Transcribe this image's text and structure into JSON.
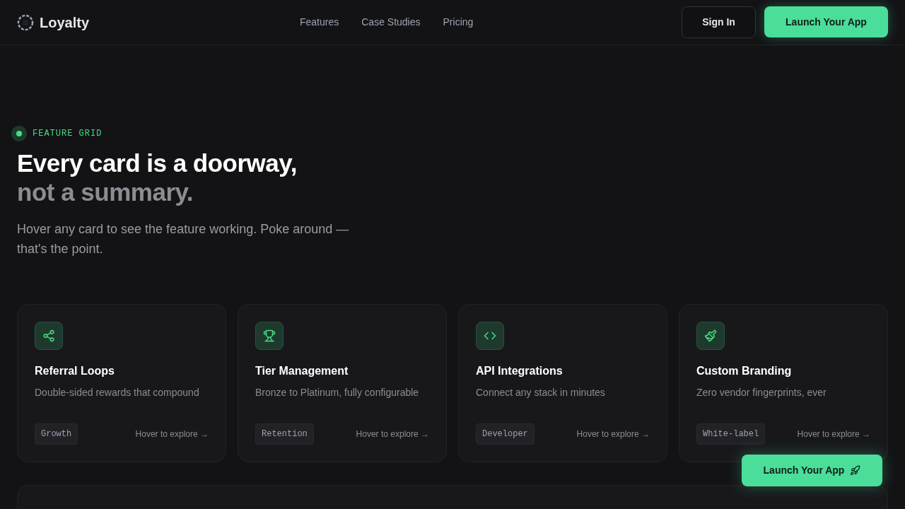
{
  "nav": {
    "brand": "Loyalty",
    "links": [
      "Features",
      "Case Studies",
      "Pricing"
    ],
    "sign_in": "Sign In",
    "cta": "Launch Your App"
  },
  "hero": {
    "eyebrow": "FEATURE GRID",
    "title_line1": "Every card is a doorway,",
    "title_line2": "not a summary.",
    "subtitle": "Hover any card to see the feature working. Poke around — that's the point."
  },
  "cards": [
    {
      "kind": "share",
      "title": "Referral Loops",
      "description": "Double-sided rewards that compound",
      "tag": "Growth",
      "link": "Hover to explore →"
    },
    {
      "kind": "trophy",
      "title": "Tier Management",
      "description": "Bronze to Platinum, fully configurable",
      "tag": "Retention",
      "link": "Hover to explore →"
    },
    {
      "kind": "code",
      "title": "API Integrations",
      "description": "Connect any stack in minutes",
      "tag": "Developer",
      "link": "Hover to explore →"
    },
    {
      "kind": "brush",
      "title": "Custom Branding",
      "description": "Zero vendor fingerprints, ever",
      "tag": "White-label",
      "link": "Hover to explore →"
    }
  ],
  "floating_cta": "Launch Your App"
}
